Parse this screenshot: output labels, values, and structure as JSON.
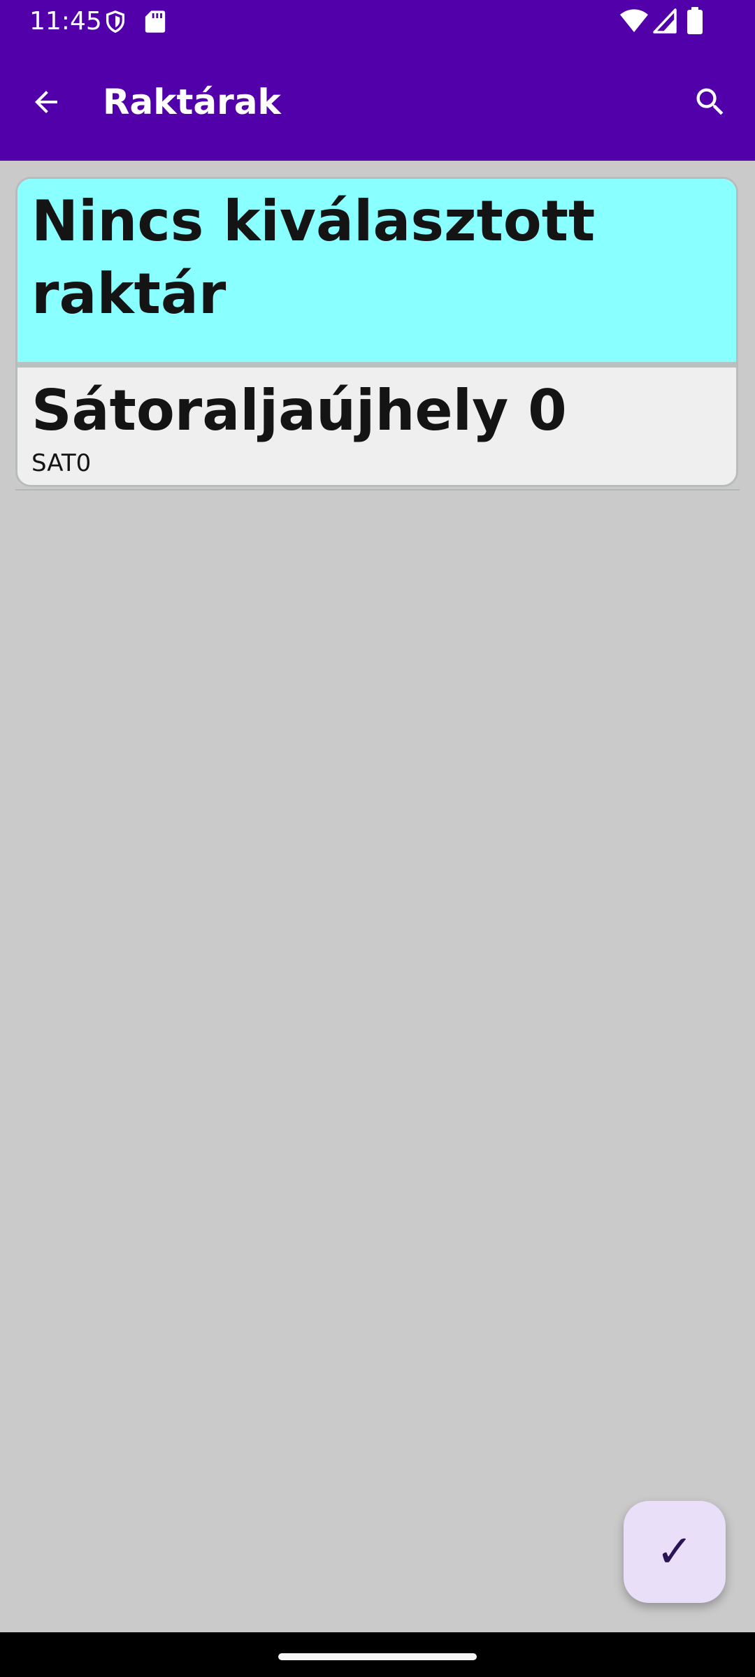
{
  "status_bar": {
    "time": "11:45",
    "left_icons": [
      "shield-icon",
      "sd-card-icon"
    ],
    "right_icons": [
      "wifi-icon",
      "signal-icon",
      "battery-icon"
    ]
  },
  "app_bar": {
    "title": "Raktárak",
    "back_icon": "arrow-back-icon",
    "search_icon": "search-icon",
    "color": "#5200aa"
  },
  "warehouse_list": {
    "items": [
      {
        "title": "Nincs kiválasztott raktár",
        "subtitle": "",
        "selected": true,
        "color": "#8affff"
      },
      {
        "title": "Sátoraljaújhely 0",
        "subtitle": "SAT0",
        "selected": false,
        "color": "#efefef"
      }
    ]
  },
  "fab": {
    "glyph": "✓",
    "icon": "check-icon",
    "color": "#eadff9"
  },
  "colors": {
    "background": "#cacaca",
    "nav_bar": "#000000"
  }
}
